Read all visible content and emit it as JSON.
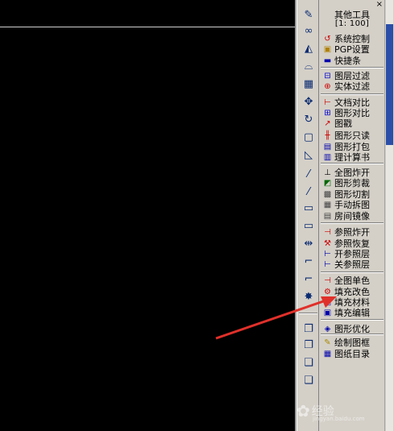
{
  "panel": {
    "title": "其他工具",
    "scale": "[1: 100]",
    "close": "×"
  },
  "menu": [
    {
      "label": "系统控制",
      "icon": "c-refresh-icon",
      "color": "#cc0000"
    },
    {
      "label": "PGP设置",
      "icon": "pgp-icon",
      "color": "#b08000"
    },
    {
      "label": "快捷条",
      "icon": "bar-icon",
      "color": "#0000aa"
    },
    {
      "label": "图层过滤",
      "icon": "layer-filter-icon",
      "color": "#0000cc"
    },
    {
      "label": "实体过滤",
      "icon": "entity-filter-icon",
      "color": "#cc0000"
    },
    {
      "label": "文档对比",
      "icon": "doc-compare-icon",
      "color": "#cc0000"
    },
    {
      "label": "图形对比",
      "icon": "graph-compare-icon",
      "color": "#0000cc"
    },
    {
      "label": "图戳",
      "icon": "stamp-icon",
      "color": "#cc0000"
    },
    {
      "label": "图形只读",
      "icon": "readonly-icon",
      "color": "#cc0000"
    },
    {
      "label": "图形打包",
      "icon": "pack-icon",
      "color": "#0000aa"
    },
    {
      "label": "理计算书",
      "icon": "calc-book-icon",
      "color": "#0000aa"
    },
    {
      "label": "全图炸开",
      "icon": "explode-all-icon",
      "color": "#000000"
    },
    {
      "label": "图形剪裁",
      "icon": "crop-icon",
      "color": "#006600"
    },
    {
      "label": "图形切割",
      "icon": "cut-icon",
      "color": "#444444"
    },
    {
      "label": "手动拆图",
      "icon": "split-icon",
      "color": "#444444"
    },
    {
      "label": "房间镜像",
      "icon": "mirror-room-icon",
      "color": "#444444"
    },
    {
      "label": "参照炸开",
      "icon": "ref-explode-icon",
      "color": "#cc0000"
    },
    {
      "label": "参照恢复",
      "icon": "ref-restore-icon",
      "color": "#cc0000"
    },
    {
      "label": "开参照层",
      "icon": "ref-layer-on-icon",
      "color": "#0000aa"
    },
    {
      "label": "关参照层",
      "icon": "ref-layer-off-icon",
      "color": "#0000aa"
    },
    {
      "label": "全图单色",
      "icon": "mono-icon",
      "color": "#cc0000"
    },
    {
      "label": "填充改色",
      "icon": "fill-color-icon",
      "color": "#cc0000"
    },
    {
      "label": "填充材料",
      "icon": "fill-material-icon",
      "color": "#0000aa"
    },
    {
      "label": "填充编辑",
      "icon": "fill-edit-icon",
      "color": "#0000aa"
    },
    {
      "label": "图形优化",
      "icon": "optimize-icon",
      "color": "#0000aa"
    },
    {
      "label": "绘制图框",
      "icon": "draw-frame-icon",
      "color": "#aa8800"
    },
    {
      "label": "图纸目录",
      "icon": "catalog-icon",
      "color": "#0000aa"
    }
  ],
  "toolbar_icons": [
    "pencil-icon",
    "link-icon",
    "mirror-icon",
    "offset-icon",
    "array-icon",
    "move-icon",
    "rotate-icon",
    "scale-icon",
    "stretch-icon",
    "trim-icon",
    "extend-icon",
    "break-icon",
    "rect-icon",
    "join-icon",
    "chamfer-icon",
    "fillet-icon",
    "explode-icon",
    "copy-icon",
    "paste-icon",
    "layer-icon",
    "layer2-icon"
  ],
  "watermark": {
    "text": "经验",
    "sub": "jingyan.baidu.com"
  }
}
